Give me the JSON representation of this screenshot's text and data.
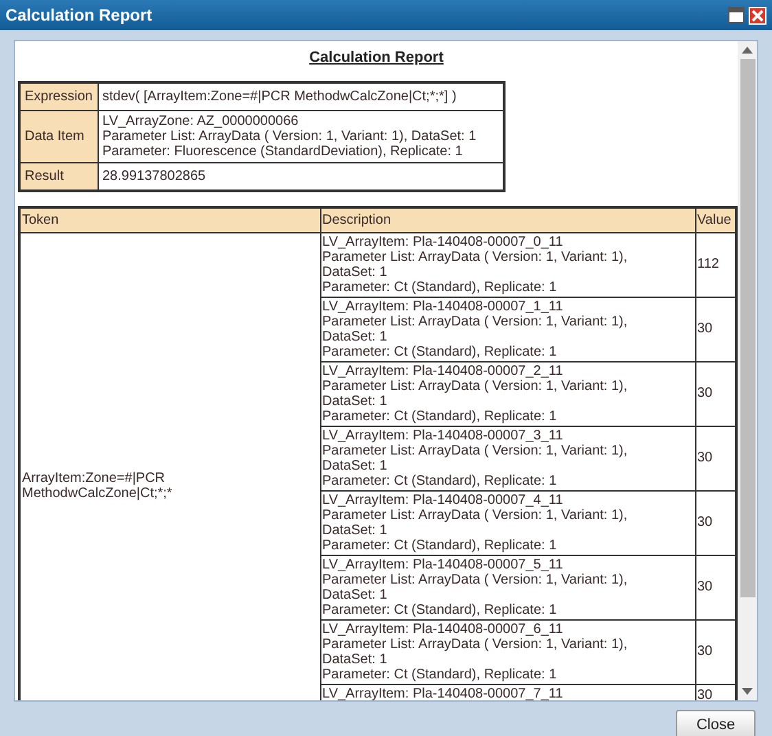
{
  "window": {
    "title": "Calculation Report"
  },
  "report_title": "Calculation Report",
  "summary": [
    {
      "label": "Expression",
      "lines": [
        "stdev( [ArrayItem:Zone=#|PCR MethodwCalcZone|Ct;*;*] )"
      ]
    },
    {
      "label": "Data Item",
      "lines": [
        "LV_ArrayZone: AZ_0000000066",
        "Parameter List: ArrayData ( Version: 1, Variant: 1), DataSet: 1",
        "Parameter: Fluorescence (StandardDeviation), Replicate: 1"
      ]
    },
    {
      "label": "Result",
      "lines": [
        "28.99137802865"
      ]
    }
  ],
  "table": {
    "columns": [
      "Token",
      "Description",
      "Value"
    ],
    "token": [
      "ArrayItem:Zone=#|PCR",
      "MethodwCalcZone|Ct;*;*"
    ],
    "rows": [
      {
        "description": [
          "LV_ArrayItem: Pla-140408-00007_0_11",
          "Parameter List: ArrayData ( Version: 1, Variant: 1),",
          "DataSet: 1",
          "Parameter: Ct (Standard), Replicate: 1"
        ],
        "value": "112"
      },
      {
        "description": [
          "LV_ArrayItem: Pla-140408-00007_1_11",
          "Parameter List: ArrayData ( Version: 1, Variant: 1),",
          "DataSet: 1",
          "Parameter: Ct (Standard), Replicate: 1"
        ],
        "value": "30"
      },
      {
        "description": [
          "LV_ArrayItem: Pla-140408-00007_2_11",
          "Parameter List: ArrayData ( Version: 1, Variant: 1),",
          "DataSet: 1",
          "Parameter: Ct (Standard), Replicate: 1"
        ],
        "value": "30"
      },
      {
        "description": [
          "LV_ArrayItem: Pla-140408-00007_3_11",
          "Parameter List: ArrayData ( Version: 1, Variant: 1),",
          "DataSet: 1",
          "Parameter: Ct (Standard), Replicate: 1"
        ],
        "value": "30"
      },
      {
        "description": [
          "LV_ArrayItem: Pla-140408-00007_4_11",
          "Parameter List: ArrayData ( Version: 1, Variant: 1),",
          "DataSet: 1",
          "Parameter: Ct (Standard), Replicate: 1"
        ],
        "value": "30"
      },
      {
        "description": [
          "LV_ArrayItem: Pla-140408-00007_5_11",
          "Parameter List: ArrayData ( Version: 1, Variant: 1),",
          "DataSet: 1",
          "Parameter: Ct (Standard), Replicate: 1"
        ],
        "value": "30"
      },
      {
        "description": [
          "LV_ArrayItem: Pla-140408-00007_6_11",
          "Parameter List: ArrayData ( Version: 1, Variant: 1),",
          "DataSet: 1",
          "Parameter: Ct (Standard), Replicate: 1"
        ],
        "value": "30"
      },
      {
        "description": [
          "LV_ArrayItem: Pla-140408-00007_7_11"
        ],
        "value": "30"
      }
    ]
  },
  "buttons": [
    "Close"
  ]
}
